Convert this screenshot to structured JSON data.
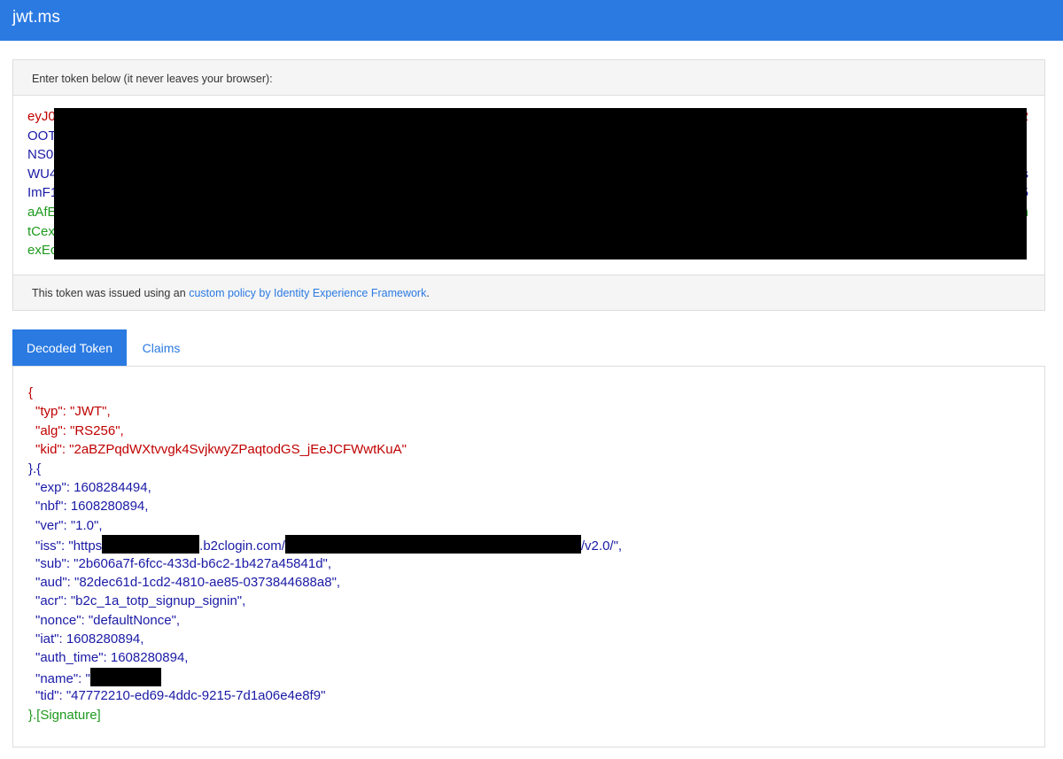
{
  "app": {
    "title": "jwt.ms"
  },
  "token_panel": {
    "header": "Enter token below (it never leaves your browser):",
    "lines": [
      {
        "start": "eyJ0",
        "end": "2",
        "color": "red"
      },
      {
        "start": "OOT",
        "end": "",
        "color": "blue"
      },
      {
        "start": "NS0",
        "end": "",
        "color": "blue"
      },
      {
        "start": "WU4",
        "end": "s",
        "color": "blue"
      },
      {
        "start": "ImF1",
        "end": "5",
        "color": "blue"
      },
      {
        "start": "aAfE",
        "end": "n",
        "color": "green"
      },
      {
        "start": "tCex",
        "end": "",
        "color": "green"
      },
      {
        "start": "exEc",
        "end": "",
        "color": "green"
      }
    ],
    "footer_prefix": "This token was issued using an ",
    "footer_link": "custom policy by Identity Experience Framework",
    "footer_suffix": "."
  },
  "tabs": [
    {
      "label": "Decoded Token",
      "active": true
    },
    {
      "label": "Claims",
      "active": false
    }
  ],
  "decoded": {
    "header_open": "{",
    "header_lines": [
      "\"typ\": \"JWT\",",
      "\"alg\": \"RS256\",",
      "\"kid\": \"2aBZPqdWXtvvgk4SvjkwyZPaqtodGS_jEeJCFWwtKuA\""
    ],
    "payload_open": "}.{",
    "payload_lines_before_iss": [
      "\"exp\": 1608284494,",
      "\"nbf\": 1608280894,",
      "\"ver\": \"1.0\","
    ],
    "iss": {
      "prefix": "\"iss\": \"https",
      "middle": ".b2clogin.com/",
      "suffix": "/v2.0/\","
    },
    "payload_lines_after_iss": [
      "\"sub\": \"2b606a7f-6fcc-433d-b6c2-1b427a45841d\",",
      "\"aud\": \"82dec61d-1cd2-4810-ae85-0373844688a8\",",
      "\"acr\": \"b2c_1a_totp_signup_signin\",",
      "\"nonce\": \"defaultNonce\",",
      "\"iat\": 1608280894,",
      "\"auth_time\": 1608280894,"
    ],
    "name_prefix": "\"name\": \"",
    "tid": "\"tid\": \"47772210-ed69-4ddc-9215-7d1a06e4e8f9\"",
    "signature": "}.[Signature]"
  },
  "colors": {
    "accent": "#2a7ae2",
    "header_text": "#c00000",
    "payload_text": "#1a1aa6",
    "signature_text": "#1e9a1e"
  }
}
